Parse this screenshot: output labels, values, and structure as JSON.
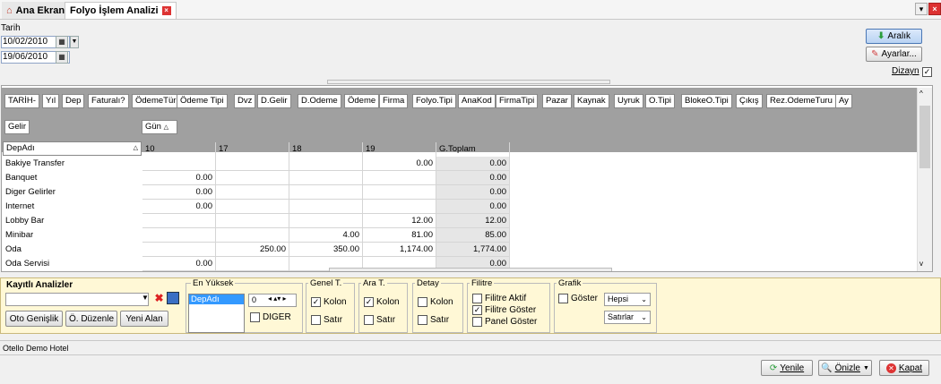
{
  "tabs": {
    "home_label": "Ana Ekran",
    "active_label": "Folyo İşlem Analizi"
  },
  "window_controls": {
    "dropdown": "▾",
    "close": "×"
  },
  "filters": {
    "date_label": "Tarih",
    "date_from": "10/02/2010",
    "date_to": "19/06/2010"
  },
  "actions": {
    "range_label": "Aralık",
    "settings_label": "Ayarlar...",
    "design_label": "Dizayn"
  },
  "fields": [
    "TARİH-",
    "Yıl",
    "Dep",
    "Faturalı?",
    "ÖdemeTürü",
    "Ödeme Tipi",
    "Dvz",
    "D.Gelir",
    "D.Odeme",
    "Ödeme",
    "Firma",
    "Folyo.Tipi",
    "AnaKod",
    "FirmaTipi",
    "Pazar",
    "Kaynak",
    "Uyruk",
    "O.Tipi",
    "BlokeO.Tipi",
    "Çıkış",
    "Rez.OdemeTuru",
    "Ay"
  ],
  "pivot": {
    "data_field": "Gelir",
    "column_field": "Gün",
    "row_field": "DepAdı",
    "columns": [
      "10",
      "17",
      "18",
      "19",
      "G.Toplam"
    ],
    "rows": [
      {
        "label": "Bakiye Transfer",
        "values": [
          "",
          "",
          "",
          "0.00",
          "0.00"
        ]
      },
      {
        "label": "Banquet",
        "values": [
          "0.00",
          "",
          "",
          "",
          "0.00"
        ]
      },
      {
        "label": "Diger Gelirler",
        "values": [
          "0.00",
          "",
          "",
          "",
          "0.00"
        ]
      },
      {
        "label": "Internet",
        "values": [
          "0.00",
          "",
          "",
          "",
          "0.00"
        ]
      },
      {
        "label": "Lobby Bar",
        "values": [
          "",
          "",
          "",
          "12.00",
          "12.00"
        ]
      },
      {
        "label": "Minibar",
        "values": [
          "",
          "",
          "4.00",
          "81.00",
          "85.00"
        ]
      },
      {
        "label": "Oda",
        "values": [
          "",
          "250.00",
          "350.00",
          "1,174.00",
          "1,774.00"
        ]
      },
      {
        "label": "Oda Servisi",
        "values": [
          "0.00",
          "",
          "",
          "",
          "0.00"
        ]
      }
    ]
  },
  "saved": {
    "title": "Kayıtlı Analizler",
    "width_btn": "Oto Genişlik",
    "edit_btn": "Ö. Düzenle",
    "new_btn": "Yeni Alan"
  },
  "top": {
    "title": "En Yüksek",
    "selected": "DepAdı",
    "count": "0",
    "other_label": "DIGER"
  },
  "genel": {
    "title": "Genel T.",
    "kolon": "Kolon",
    "satir": "Satır"
  },
  "ara": {
    "title": "Ara T.",
    "kolon": "Kolon",
    "satir": "Satır"
  },
  "detay": {
    "title": "Detay",
    "kolon": "Kolon",
    "satir": "Satır"
  },
  "filtre": {
    "title": "Filitre",
    "aktif": "Filitre Aktif",
    "goster": "Filitre Göster",
    "panel": "Panel Göster"
  },
  "grafik": {
    "title": "Grafik",
    "goster": "Göster",
    "opt1": "Hepsi",
    "opt2": "Satırlar"
  },
  "status_text": "Otello Demo Hotel",
  "footer": {
    "refresh": "Yenile",
    "preview": "Önizle",
    "close": "Kapat"
  }
}
